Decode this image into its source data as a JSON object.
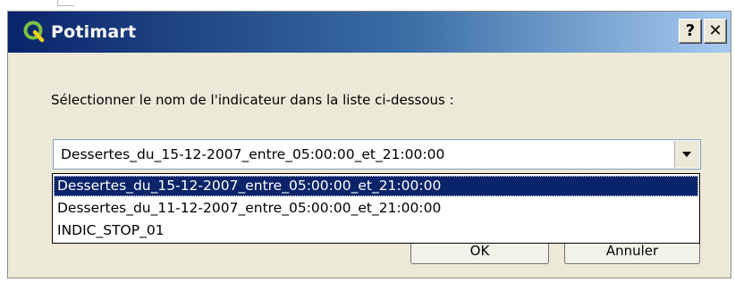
{
  "window": {
    "title": "Potimart",
    "help_label": "?",
    "close_label": "✕",
    "icon": "qgis-q-icon",
    "title_bar_color": "#0a246a"
  },
  "prompt": {
    "text": "Sélectionner le nom de l'indicateur dans la liste ci-dessous :"
  },
  "indicator_select": {
    "selected_value": "Dessertes_du_15-12-2007_entre_05:00:00_et_21:00:00",
    "options": [
      "Dessertes_du_15-12-2007_entre_05:00:00_et_21:00:00",
      "Dessertes_du_11-12-2007_entre_05:00:00_et_21:00:00",
      "INDIC_STOP_01"
    ],
    "highlighted_index": 0,
    "highlight_color": "#0a246a"
  },
  "buttons": {
    "ok_label": "OK",
    "cancel_label": "Annuler"
  }
}
